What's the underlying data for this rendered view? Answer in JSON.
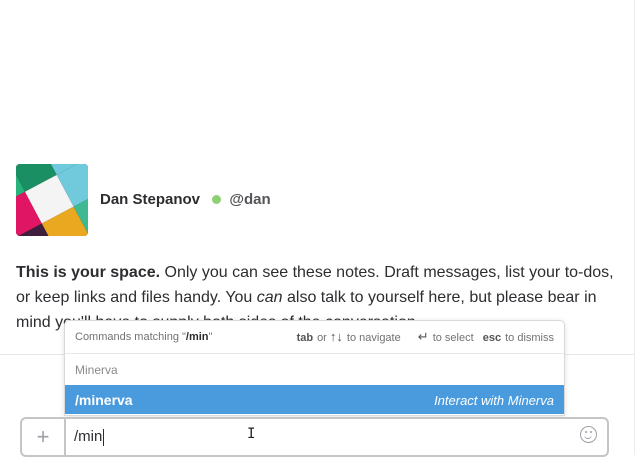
{
  "profile": {
    "name": "Dan Stepanov",
    "handle": "@dan",
    "presence_color": "#8ecf74"
  },
  "intro": {
    "bold": "This is your space.",
    "text1": " Only you can see these notes. Draft messages, list your to-dos, or keep links and files handy. You ",
    "italic": "can",
    "text2": " also talk to yourself here, but please bear in mind you'll have to supply both sides of the conversation."
  },
  "autocomplete": {
    "header_prefix": "Commands matching \"",
    "query": "/min",
    "header_suffix": "\"",
    "hint_tab": "tab",
    "hint_or": "or",
    "hint_up_down": "↑↓",
    "hint_navigate": "to navigate",
    "hint_enter": "↵",
    "hint_select": "to select",
    "hint_esc": "esc",
    "hint_dismiss": "to dismiss",
    "group": "Minerva",
    "items": [
      {
        "command": "/minerva",
        "description": "Interact with Minerva"
      }
    ],
    "highlight_color": "#4a9bde"
  },
  "composer": {
    "plus_icon": "plus-icon",
    "value": "/min",
    "emoji_icon": "smiley-icon"
  }
}
